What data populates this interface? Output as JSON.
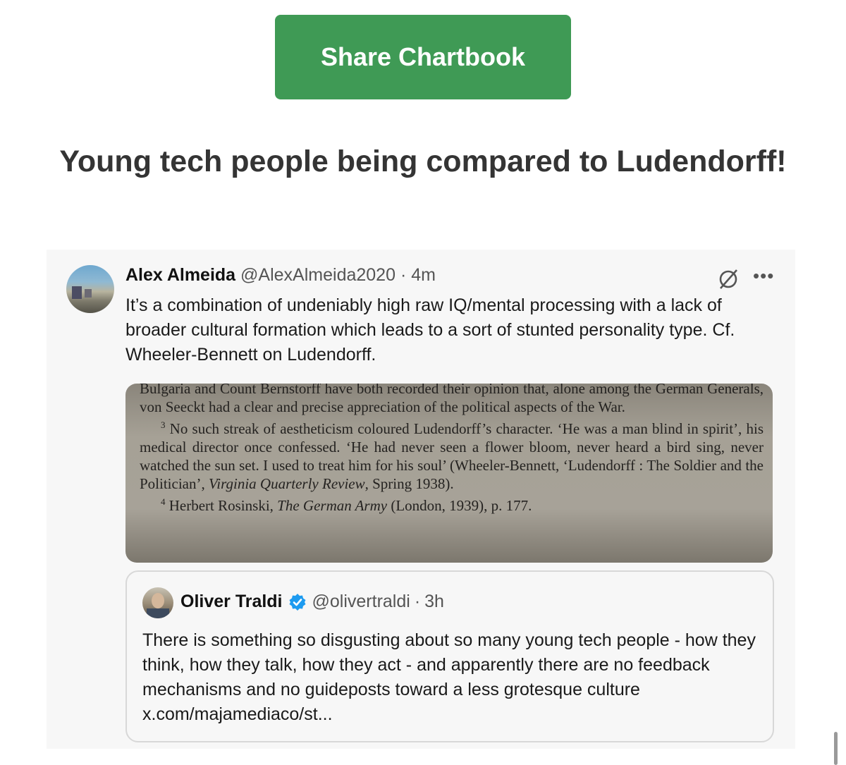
{
  "share_button": {
    "label": "Share Chartbook",
    "color": "#3f9a55"
  },
  "headline": "Young tech people being compared to Ludendorff!",
  "tweet": {
    "author_name": "Alex Almeida",
    "author_handle": "@AlexAlmeida2020",
    "time": "4m",
    "text": "It’s a combination of undeniably high raw IQ/mental processing with a lack of broader cultural formation which leads to a sort of stunted personality type. Cf. Wheeler-Bennett on Ludendorff.",
    "icons": [
      "grok-icon",
      "more-icon"
    ],
    "image_text": {
      "line1": "Bulgaria and Count Bernstorff have both recorded their opinion that, alone among the German Generals, von Seeckt had a clear and precise appreciation of the political aspects of the War.",
      "fn3_num": "3",
      "fn3": " No such streak of aestheticism coloured Ludendorff’s character. ‘He was a man blind in spirit’, his medical director once confessed. ‘He had never seen a flower bloom, never heard a bird sing, never watched the sun set. I used to treat him for his soul’ (Wheeler-Bennett, ‘Ludendorff : The Soldier and the Politician’, ",
      "fn3_journal": "Virginia Quarterly Review",
      "fn3_end": ", Spring 1938).",
      "fn4_num": "4",
      "fn4_a": " Herbert Rosinski, ",
      "fn4_book": "The German Army",
      "fn4_b": " (London, 1939), p. 177."
    },
    "quoted": {
      "author_name": "Oliver Traldi",
      "author_handle": "@olivertraldi",
      "time": "3h",
      "text": "There is something so disgusting about so many young tech people - how they think, how they talk, how they act - and apparently there are no feedback mechanisms and no guideposts toward a less grotesque culture x.com/majamediaco/st..."
    }
  }
}
